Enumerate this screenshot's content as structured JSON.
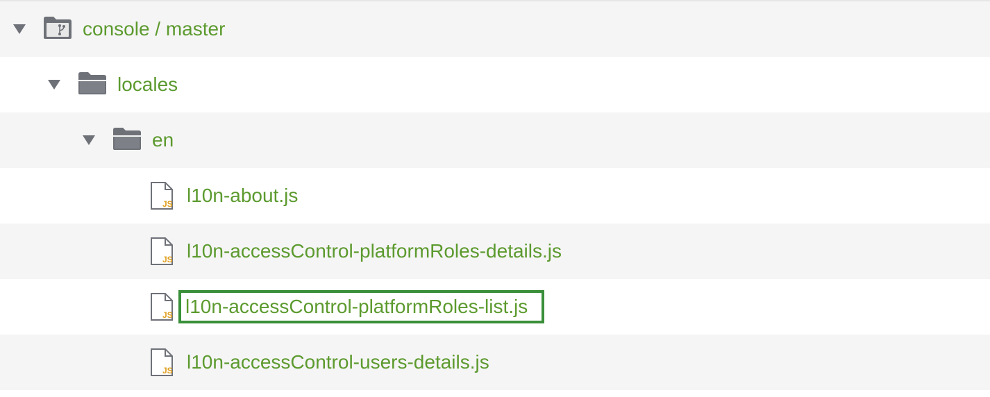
{
  "tree": {
    "root": {
      "label": "console / master",
      "icon": "repo-branch-folder-icon",
      "expanded": true
    },
    "locales": {
      "label": "locales",
      "icon": "folder-icon",
      "expanded": true
    },
    "en": {
      "label": "en",
      "icon": "folder-icon",
      "expanded": true
    },
    "files": [
      {
        "label": "l10n-about.js",
        "icon": "js-file-icon"
      },
      {
        "label": "l10n-accessControl-platformRoles-details.js",
        "icon": "js-file-icon"
      },
      {
        "label": "l10n-accessControl-platformRoles-list.js",
        "icon": "js-file-icon",
        "selected": true
      },
      {
        "label": "l10n-accessControl-users-details.js",
        "icon": "js-file-icon"
      }
    ],
    "js_badge": "JS"
  },
  "colors": {
    "label": "#5c9a2e",
    "icon": "#6e7178",
    "js_badge": "#e0a020",
    "selection_border": "#3a8f3a",
    "row_alt": "#f5f5f5"
  }
}
